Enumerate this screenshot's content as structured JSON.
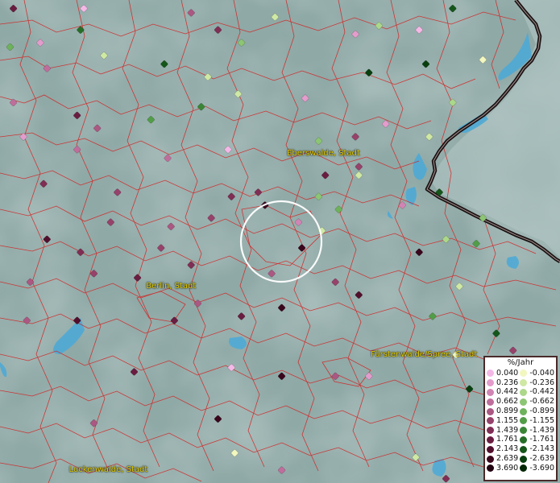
{
  "colors": {
    "background": "#8fa9a6",
    "land_light": "#a6bdbb",
    "water": "#4aa9d8",
    "district_border": "#d42020",
    "country_border": "#1a1010",
    "label_text": "#e8d000",
    "focus_ring": "#ffffff"
  },
  "cities": [
    {
      "name": "Eberswalde, Stadt",
      "lon": 13.82,
      "lat": 52.83
    },
    {
      "name": "Berlin, Stadt",
      "lon": 13.4,
      "lat": 52.52
    },
    {
      "name": "Fürstenwalde/Spree, Stadt",
      "lon": 14.07,
      "lat": 52.36
    },
    {
      "name": "Luckenwalde, Stadt",
      "lon": 13.17,
      "lat": 52.09
    }
  ],
  "legend": {
    "title": "%/Jahr",
    "positive": [
      {
        "label": "0.040",
        "color": "#f4b8e6"
      },
      {
        "label": "0.236",
        "color": "#e39ccc"
      },
      {
        "label": "0.442",
        "color": "#d185b4"
      },
      {
        "label": "0.662",
        "color": "#bf6e9c"
      },
      {
        "label": "0.899",
        "color": "#ab5883"
      },
      {
        "label": "1.155",
        "color": "#96426b"
      },
      {
        "label": "1.439",
        "color": "#802e54"
      },
      {
        "label": "1.761",
        "color": "#6a1d40"
      },
      {
        "label": "2.143",
        "color": "#520f2d"
      },
      {
        "label": "2.639",
        "color": "#3a061c"
      },
      {
        "label": "3.690",
        "color": "#220210"
      }
    ],
    "negative": [
      {
        "label": "-0.040",
        "color": "#f2f7c0"
      },
      {
        "label": "-0.236",
        "color": "#cfe8a4"
      },
      {
        "label": "-0.442",
        "color": "#acd88a"
      },
      {
        "label": "-0.662",
        "color": "#8cc573"
      },
      {
        "label": "-0.899",
        "color": "#6eb25c"
      },
      {
        "label": "-1.155",
        "color": "#529d48"
      },
      {
        "label": "-1.439",
        "color": "#3a8637"
      },
      {
        "label": "-1.761",
        "color": "#266e28"
      },
      {
        "label": "-2.143",
        "color": "#15561a"
      },
      {
        "label": "-2.639",
        "color": "#083f0e"
      },
      {
        "label": "-3.690",
        "color": "#022805"
      }
    ]
  },
  "stations": [
    {
      "lon": 12.99,
      "lat": 53.17,
      "v": 1.8
    },
    {
      "lon": 13.2,
      "lat": 53.17,
      "v": 0.1
    },
    {
      "lon": 13.52,
      "lat": 53.16,
      "v": 1.0
    },
    {
      "lon": 13.77,
      "lat": 53.15,
      "v": -0.3
    },
    {
      "lon": 14.3,
      "lat": 53.17,
      "v": -2.6
    },
    {
      "lon": 13.19,
      "lat": 53.12,
      "v": -1.9
    },
    {
      "lon": 13.6,
      "lat": 53.12,
      "v": 1.5
    },
    {
      "lon": 14.01,
      "lat": 53.11,
      "v": 0.3
    },
    {
      "lon": 14.08,
      "lat": 53.13,
      "v": -0.5
    },
    {
      "lon": 14.2,
      "lat": 53.12,
      "v": 0.1
    },
    {
      "lon": 13.67,
      "lat": 53.09,
      "v": -0.8
    },
    {
      "lon": 12.98,
      "lat": 53.08,
      "v": -1.0
    },
    {
      "lon": 13.07,
      "lat": 53.09,
      "v": 0.4
    },
    {
      "lon": 13.26,
      "lat": 53.06,
      "v": -0.4
    },
    {
      "lon": 13.44,
      "lat": 53.04,
      "v": -2.6
    },
    {
      "lon": 13.09,
      "lat": 53.03,
      "v": 0.8
    },
    {
      "lon": 13.57,
      "lat": 53.01,
      "v": -0.3
    },
    {
      "lon": 14.05,
      "lat": 53.02,
      "v": -3.6
    },
    {
      "lon": 14.22,
      "lat": 53.04,
      "v": -3.6
    },
    {
      "lon": 14.39,
      "lat": 53.05,
      "v": -0.2
    },
    {
      "lon": 12.99,
      "lat": 52.95,
      "v": 0.7
    },
    {
      "lon": 13.18,
      "lat": 52.92,
      "v": 1.9
    },
    {
      "lon": 13.24,
      "lat": 52.89,
      "v": 1.1
    },
    {
      "lon": 13.4,
      "lat": 52.91,
      "v": -1.3
    },
    {
      "lon": 13.55,
      "lat": 52.94,
      "v": -1.6
    },
    {
      "lon": 13.66,
      "lat": 52.97,
      "v": -0.3
    },
    {
      "lon": 13.86,
      "lat": 52.96,
      "v": 0.3
    },
    {
      "lon": 14.1,
      "lat": 52.9,
      "v": 0.4
    },
    {
      "lon": 14.23,
      "lat": 52.87,
      "v": -0.4
    },
    {
      "lon": 14.3,
      "lat": 52.95,
      "v": -0.5
    },
    {
      "lon": 14.01,
      "lat": 52.87,
      "v": 1.3
    },
    {
      "lon": 13.02,
      "lat": 52.87,
      "v": 0.4
    },
    {
      "lon": 13.18,
      "lat": 52.84,
      "v": 0.8
    },
    {
      "lon": 13.45,
      "lat": 52.82,
      "v": 0.7
    },
    {
      "lon": 13.63,
      "lat": 52.84,
      "v": 0.1
    },
    {
      "lon": 13.9,
      "lat": 52.86,
      "v": -0.7
    },
    {
      "lon": 14.02,
      "lat": 52.8,
      "v": 1.4
    },
    {
      "lon": 13.08,
      "lat": 52.76,
      "v": 1.7
    },
    {
      "lon": 13.3,
      "lat": 52.74,
      "v": 1.4
    },
    {
      "lon": 13.64,
      "lat": 52.73,
      "v": 1.5
    },
    {
      "lon": 13.72,
      "lat": 52.74,
      "v": 1.7
    },
    {
      "lon": 13.92,
      "lat": 52.78,
      "v": 1.9
    },
    {
      "lon": 13.9,
      "lat": 52.73,
      "v": -0.8
    },
    {
      "lon": 14.02,
      "lat": 52.78,
      "v": -0.3
    },
    {
      "lon": 14.26,
      "lat": 52.74,
      "v": -2.6
    },
    {
      "lon": 13.28,
      "lat": 52.67,
      "v": 1.2
    },
    {
      "lon": 13.46,
      "lat": 52.66,
      "v": 1.0
    },
    {
      "lon": 13.58,
      "lat": 52.68,
      "v": 1.4
    },
    {
      "lon": 13.74,
      "lat": 52.71,
      "v": 3.2
    },
    {
      "lon": 13.84,
      "lat": 52.67,
      "v": 0.6
    },
    {
      "lon": 13.96,
      "lat": 52.7,
      "v": -0.9
    },
    {
      "lon": 14.15,
      "lat": 52.71,
      "v": 0.5
    },
    {
      "lon": 14.39,
      "lat": 52.68,
      "v": -0.7
    },
    {
      "lon": 13.09,
      "lat": 52.63,
      "v": 2.5
    },
    {
      "lon": 13.19,
      "lat": 52.6,
      "v": 1.6
    },
    {
      "lon": 13.04,
      "lat": 52.53,
      "v": 0.9
    },
    {
      "lon": 13.23,
      "lat": 52.55,
      "v": 1.3
    },
    {
      "lon": 13.36,
      "lat": 52.54,
      "v": 2.0
    },
    {
      "lon": 13.43,
      "lat": 52.61,
      "v": 1.4
    },
    {
      "lon": 13.52,
      "lat": 52.57,
      "v": 1.7
    },
    {
      "lon": 13.76,
      "lat": 52.55,
      "v": 1.0
    },
    {
      "lon": 13.85,
      "lat": 52.61,
      "v": 2.7
    },
    {
      "lon": 13.91,
      "lat": 52.65,
      "v": -0.3
    },
    {
      "lon": 14.2,
      "lat": 52.6,
      "v": 3.6
    },
    {
      "lon": 14.28,
      "lat": 52.63,
      "v": -0.6
    },
    {
      "lon": 14.32,
      "lat": 52.52,
      "v": -0.4
    },
    {
      "lon": 14.37,
      "lat": 52.62,
      "v": -1.3
    },
    {
      "lon": 13.03,
      "lat": 52.44,
      "v": 0.9
    },
    {
      "lon": 13.18,
      "lat": 52.44,
      "v": 2.6
    },
    {
      "lon": 13.47,
      "lat": 52.44,
      "v": 1.9
    },
    {
      "lon": 13.54,
      "lat": 52.48,
      "v": 1.1
    },
    {
      "lon": 13.67,
      "lat": 52.45,
      "v": 2.1
    },
    {
      "lon": 13.79,
      "lat": 52.47,
      "v": 3.4
    },
    {
      "lon": 13.95,
      "lat": 52.53,
      "v": 1.2
    },
    {
      "lon": 14.02,
      "lat": 52.5,
      "v": 2.4
    },
    {
      "lon": 14.24,
      "lat": 52.45,
      "v": -1.3
    },
    {
      "lon": 14.48,
      "lat": 52.37,
      "v": 1.3
    },
    {
      "lon": 13.95,
      "lat": 52.31,
      "v": 0.9
    },
    {
      "lon": 13.35,
      "lat": 52.32,
      "v": 2.1
    },
    {
      "lon": 13.64,
      "lat": 52.33,
      "v": 0.2
    },
    {
      "lon": 13.79,
      "lat": 52.31,
      "v": 3.6
    },
    {
      "lon": 14.05,
      "lat": 52.31,
      "v": 0.4
    },
    {
      "lon": 14.31,
      "lat": 52.36,
      "v": -0.1
    },
    {
      "lon": 14.43,
      "lat": 52.41,
      "v": -2.6
    },
    {
      "lon": 13.6,
      "lat": 52.21,
      "v": 3.6
    },
    {
      "lon": 13.23,
      "lat": 52.2,
      "v": 0.9
    },
    {
      "lon": 13.65,
      "lat": 52.13,
      "v": -0.2
    },
    {
      "lon": 13.79,
      "lat": 52.09,
      "v": 0.7
    },
    {
      "lon": 14.28,
      "lat": 52.07,
      "v": 1.6
    },
    {
      "lon": 14.35,
      "lat": 52.28,
      "v": -3.2
    },
    {
      "lon": 14.42,
      "lat": 52.17,
      "v": -0.1
    },
    {
      "lon": 14.48,
      "lat": 52.2,
      "v": 1.1
    },
    {
      "lon": 14.19,
      "lat": 52.12,
      "v": -0.3
    }
  ]
}
